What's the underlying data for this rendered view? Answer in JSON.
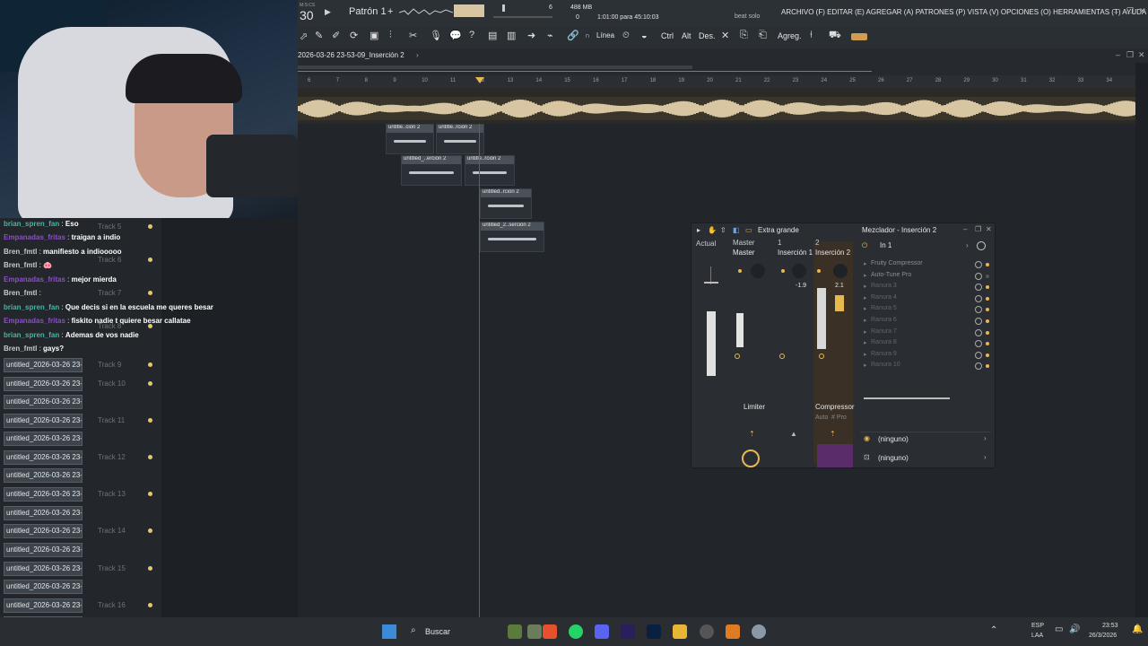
{
  "topbar": {
    "bpm": "30",
    "bpm_label": "M:S:CS",
    "pattern": "Patrón 1",
    "memory": "488 MB",
    "memory_counter": "0",
    "time_status": "1:01:00 para 45:10:03",
    "voice_count": "6",
    "hint": "beat solo",
    "menu": [
      "ARCHIVO (F)",
      "EDITAR (E)",
      "AGREGAR (A)",
      "PATRONES (P)",
      "VISTA (V)",
      "OPCIONES (O)",
      "HERRAMIENTAS (T)",
      "AYUDA"
    ]
  },
  "toolbar": {
    "snap_label": "Línea",
    "ctrl": "Ctrl",
    "alt": "Alt",
    "des": "Des.",
    "agreg": "Agreg."
  },
  "playlist": {
    "title": "2026-03-26 23-53-09_Inserción 2",
    "ruler": [
      "6",
      "7",
      "8",
      "9",
      "10",
      "11",
      "12",
      "13",
      "14",
      "15",
      "16",
      "17",
      "18",
      "19",
      "20",
      "21",
      "22",
      "23",
      "24",
      "25",
      "26",
      "27",
      "28",
      "29",
      "30",
      "31",
      "32",
      "33",
      "34"
    ],
    "clips": [
      {
        "label": "untitle..ción 2"
      },
      {
        "label": "untitle..rción 2"
      },
      {
        "label": "untitled_..erción 2"
      },
      {
        "label": "untitle..rción 2"
      },
      {
        "label": "untitled..rción 2"
      },
      {
        "label": "untitled_2..serción 2"
      }
    ]
  },
  "tracks": [
    {
      "name": "",
      "label": "Track 5"
    },
    {
      "name": "",
      "label": "Track 6"
    },
    {
      "name": "",
      "label": "Track 7"
    },
    {
      "name": "",
      "label": "Track 8"
    },
    {
      "name": "untitled_2026-03-26 23-...",
      "label": "Track 9"
    },
    {
      "name": "untitled_2026-03-26 23-...",
      "label": "Track 10"
    },
    {
      "name": "untitled_2026-03-26 23-...",
      "label": ""
    },
    {
      "name": "untitled_2026-03-26 23-...",
      "label": "Track 11"
    },
    {
      "name": "untitled_2026-03-26 23-...",
      "label": ""
    },
    {
      "name": "untitled_2026-03-26 23-...",
      "label": "Track 12"
    },
    {
      "name": "untitled_2026-03-26 23-...",
      "label": ""
    },
    {
      "name": "untitled_2026-03-26 23-...",
      "label": "Track 13"
    },
    {
      "name": "untitled_2026-03-26 23-...",
      "label": ""
    },
    {
      "name": "untitled_2026-03-26 23-...",
      "label": "Track 14"
    },
    {
      "name": "untitled_2026-03-26 23-...",
      "label": ""
    },
    {
      "name": "untitled_2026-03-26 23-...",
      "label": "Track 15"
    },
    {
      "name": "untitled_2026-03-26 23-...",
      "label": ""
    },
    {
      "name": "untitled_2026-03-26 23-...",
      "label": "Track 16"
    },
    {
      "name": "untitled_2026-03-26 23-...",
      "label": ""
    }
  ],
  "chat": [
    {
      "user": "brian_spren_fan",
      "color": "#46b5a5",
      "text": "Eso"
    },
    {
      "user": "Empanadas_fritas",
      "color": "#8a4fc4",
      "text": "traigan a indio"
    },
    {
      "user": "Bren_fmtl",
      "color": "#c8c8c8",
      "text": "manifiesto a indiooooo"
    },
    {
      "user": "Bren_fmtl",
      "color": "#c8c8c8",
      "text": "🐽"
    },
    {
      "user": "Empanadas_fritas",
      "color": "#8a4fc4",
      "text": "mejor mierda"
    },
    {
      "user": "Bren_fmtl",
      "color": "#c8c8c8",
      "text": ""
    },
    {
      "user": "brian_spren_fan",
      "color": "#46b5a5",
      "text": "Que decis si en la escuela me queres besar"
    },
    {
      "user": "Empanadas_fritas",
      "color": "#8a4fc4",
      "text": "fiskito nadie t quiere besar callatae"
    },
    {
      "user": "brian_spren_fan",
      "color": "#46b5a5",
      "text": "Ademas de vos nadie"
    },
    {
      "user": "Bren_fmtl",
      "color": "#c8c8c8",
      "text": "gays?"
    }
  ],
  "mixer": {
    "preset": "Extra grande",
    "title": "Mezclador - Inserción 2",
    "input": "In 1",
    "current_label": "Actual",
    "strips": [
      {
        "num": "",
        "name": "Master",
        "sub": "Master",
        "plugin": "Limiter",
        "level": "-1.9"
      },
      {
        "num": "1",
        "name": "Inserción 1",
        "sub": "",
        "plugin": "",
        "level": ""
      },
      {
        "num": "2",
        "name": "Inserción 2",
        "sub": "",
        "plugin": "Compressor",
        "level": "2.1"
      }
    ],
    "auto_label": "Auto",
    "pro_label": "# Pro",
    "slots": [
      "Fruity Compressor",
      "Auto-Tune Pro",
      "Ranura 3",
      "Ranura 4",
      "Ranura 5",
      "Ranura 6",
      "Ranura 7",
      "Ranura 8",
      "Ranura 9",
      "Ranura 10"
    ],
    "send1": "(ninguno)",
    "send2": "(ninguno)"
  },
  "taskbar": {
    "search": "Buscar",
    "lang": "ESP",
    "region": "LAA",
    "time": "23:53",
    "date": "26/3/2026"
  },
  "colors": {
    "accent": "#e5b33b",
    "waveform": "#d8c6a2",
    "clip_header": "#4a5158"
  }
}
